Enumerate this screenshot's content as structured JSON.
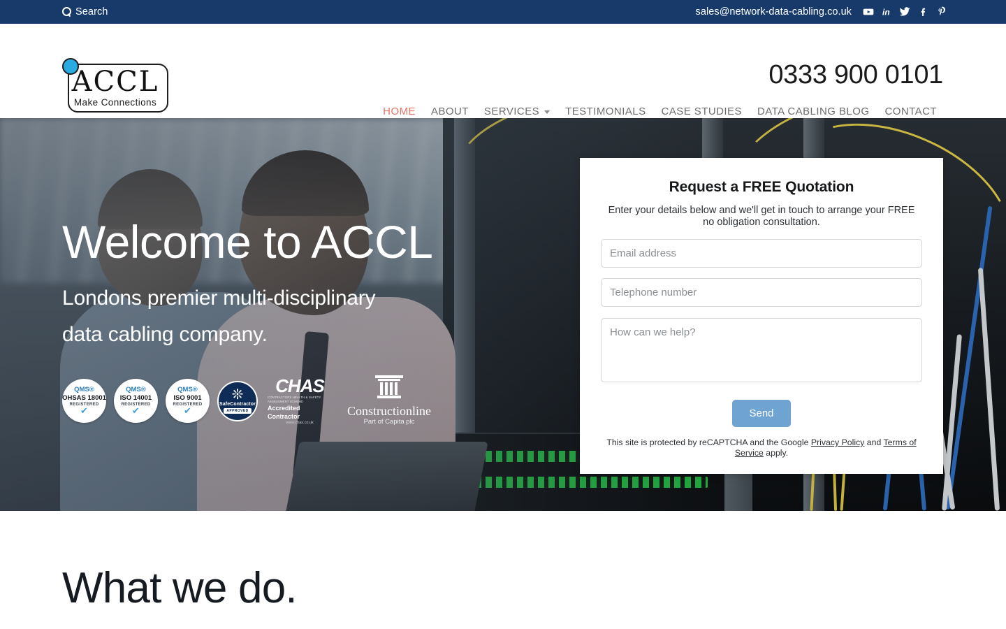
{
  "topbar": {
    "search_label": "Search",
    "search_icon": "search-icon",
    "email": "sales@network-data-cabling.co.uk",
    "socials": [
      {
        "name": "youtube",
        "title": "YouTube"
      },
      {
        "name": "linkedin",
        "title": "LinkedIn"
      },
      {
        "name": "twitter",
        "title": "Twitter"
      },
      {
        "name": "facebook",
        "title": "Facebook"
      },
      {
        "name": "pinterest",
        "title": "Pinterest"
      }
    ],
    "bar_color": "#173a6a"
  },
  "header": {
    "logo": {
      "wordmark": "ACCL",
      "tagline": "Make Connections",
      "dot_color": "#29abe2"
    },
    "phone": "0333 900 0101",
    "nav": [
      {
        "label": "HOME",
        "active": true
      },
      {
        "label": "ABOUT",
        "active": false
      },
      {
        "label": "SERVICES",
        "active": false,
        "has_dropdown": true
      },
      {
        "label": "TESTIMONIALS",
        "active": false
      },
      {
        "label": "CASE STUDIES",
        "active": false
      },
      {
        "label": "DATA CABLING BLOG",
        "active": false
      },
      {
        "label": "CONTACT",
        "active": false
      }
    ],
    "active_color": "#e8756a",
    "inactive_color": "#6d6d6d"
  },
  "hero": {
    "title": "Welcome to ACCL",
    "subtitle_line1": "Londons premier multi-disciplinary",
    "subtitle_line2": "data cabling company.",
    "badges": [
      {
        "type": "qms",
        "brand": "QMS®",
        "standard": "OHSAS 18001",
        "status": "REGISTERED",
        "tick": "✔"
      },
      {
        "type": "qms",
        "brand": "QMS®",
        "standard": "ISO 14001",
        "status": "REGISTERED",
        "tick": "✔"
      },
      {
        "type": "qms",
        "brand": "QMS®",
        "standard": "ISO 9001",
        "status": "REGISTERED",
        "tick": "✔"
      },
      {
        "type": "safecontractor",
        "name": "SafeContractor",
        "status": "APPROVED"
      },
      {
        "type": "chas",
        "name": "CHAS",
        "scheme": "CONTRACTORS HEALTH & SAFETY ASSESSMENT SCHEME",
        "status": "Accredited Contractor",
        "url": "www.chas.co.uk"
      },
      {
        "type": "constructionline",
        "name": "Constructionline",
        "status": "Part of Capita plc"
      }
    ]
  },
  "quote_form": {
    "title": "Request a FREE Quotation",
    "description": "Enter your details below and we'll get in touch to arrange your FREE no obligation consultation.",
    "email_placeholder": "Email address",
    "email_value": "",
    "phone_placeholder": "Telephone number",
    "phone_value": "",
    "message_placeholder": "How can we help?",
    "message_value": "",
    "send_label": "Send",
    "send_color": "#6fa3d2",
    "recaptcha_prefix": "This site is protected by reCAPTCHA and the Google ",
    "recaptcha_privacy": "Privacy Policy",
    "recaptcha_mid": " and ",
    "recaptcha_terms": "Terms of Service",
    "recaptcha_suffix": " apply."
  },
  "what_we_do": {
    "title": "What we do."
  }
}
